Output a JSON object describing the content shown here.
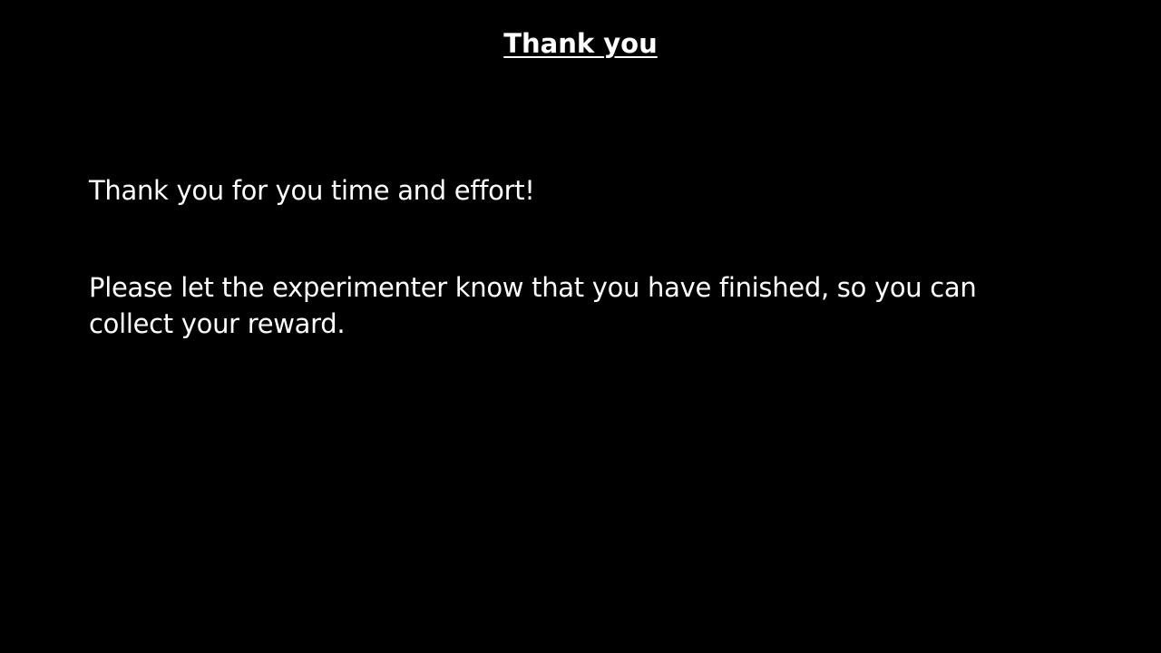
{
  "slide": {
    "title": "Thank you",
    "paragraphs": [
      "Thank you for you time and effort!",
      "Please let the experimenter know that you have finished, so you can collect your reward."
    ]
  },
  "colors": {
    "background": "#000000",
    "text": "#ffffff"
  }
}
